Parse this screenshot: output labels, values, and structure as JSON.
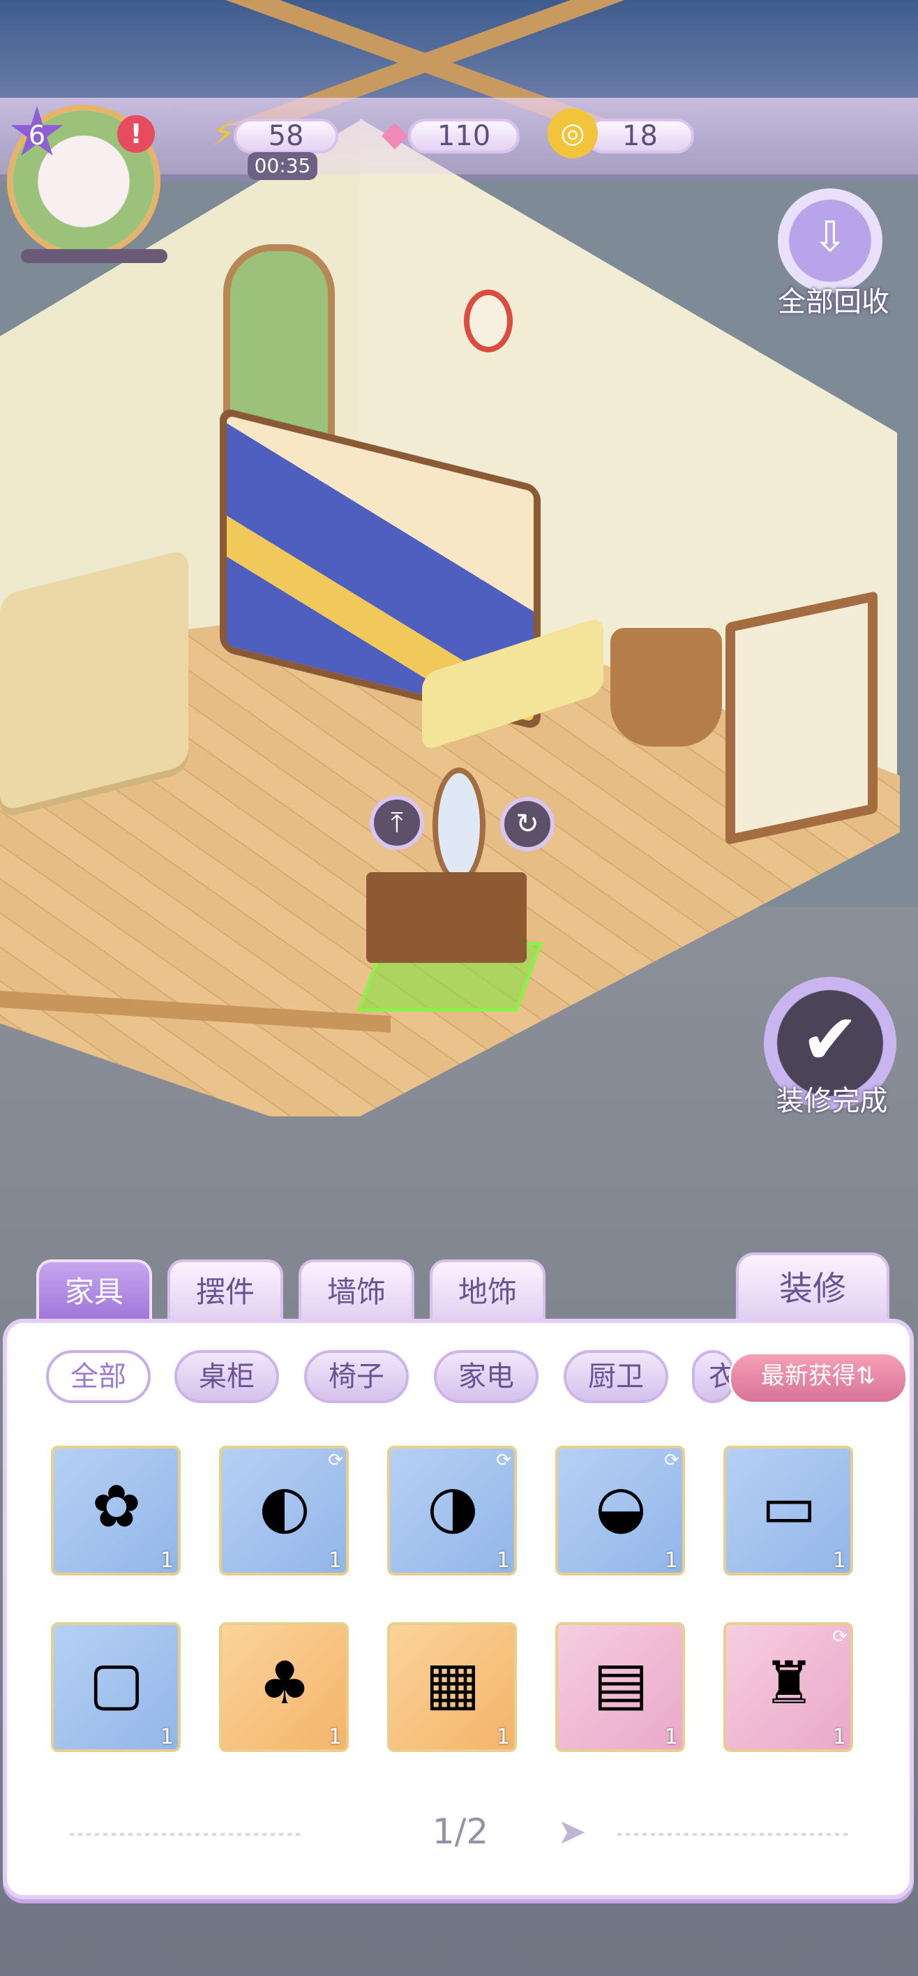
{
  "hud": {
    "level": "6",
    "alert": "!",
    "energy": "58",
    "energy_timer": "00:35",
    "gems": "110",
    "coins": "18"
  },
  "buttons": {
    "recall_all": "全部回收",
    "finish_decorating": "装修完成"
  },
  "tabs": [
    {
      "label": "家具",
      "active": true
    },
    {
      "label": "摆件",
      "active": false
    },
    {
      "label": "墙饰",
      "active": false
    },
    {
      "label": "地饰",
      "active": false
    }
  ],
  "fitment_tab": "装修",
  "filters": [
    {
      "label": "全部",
      "active": true
    },
    {
      "label": "桌柜",
      "active": false
    },
    {
      "label": "椅子",
      "active": false
    },
    {
      "label": "家电",
      "active": false
    },
    {
      "label": "厨卫",
      "active": false
    },
    {
      "label": "衣",
      "active": false
    }
  ],
  "sort_label": "最新获得⇅",
  "items": [
    {
      "icon": "flower-cushion-icon",
      "glyph": "✿",
      "bg": "blue",
      "count": "1",
      "rotatable": false
    },
    {
      "icon": "egg-chair-icon",
      "glyph": "◐",
      "bg": "blue",
      "count": "1",
      "rotatable": true
    },
    {
      "icon": "egg-chair-spotted-icon",
      "glyph": "◑",
      "bg": "blue",
      "count": "1",
      "rotatable": true
    },
    {
      "icon": "egg-chair-paw-icon",
      "glyph": "◒",
      "bg": "blue",
      "count": "1",
      "rotatable": true
    },
    {
      "icon": "lace-cabinet-icon",
      "glyph": "▭",
      "bg": "blue",
      "count": "1",
      "rotatable": false
    },
    {
      "icon": "ottoman-icon",
      "glyph": "▢",
      "bg": "blue",
      "count": "1",
      "rotatable": false
    },
    {
      "icon": "mushroom-stump-set-icon",
      "glyph": "♣",
      "bg": "orange",
      "count": "1",
      "rotatable": false
    },
    {
      "icon": "brick-fireplace-icon",
      "glyph": "▦",
      "bg": "orange",
      "count": "1",
      "rotatable": false
    },
    {
      "icon": "nightstand-icon",
      "glyph": "▤",
      "bg": "pink",
      "count": "1",
      "rotatable": false
    },
    {
      "icon": "wooden-chair-icon",
      "glyph": "♜",
      "bg": "pink",
      "count": "1",
      "rotatable": true
    }
  ],
  "pager": {
    "text": "1/2"
  }
}
